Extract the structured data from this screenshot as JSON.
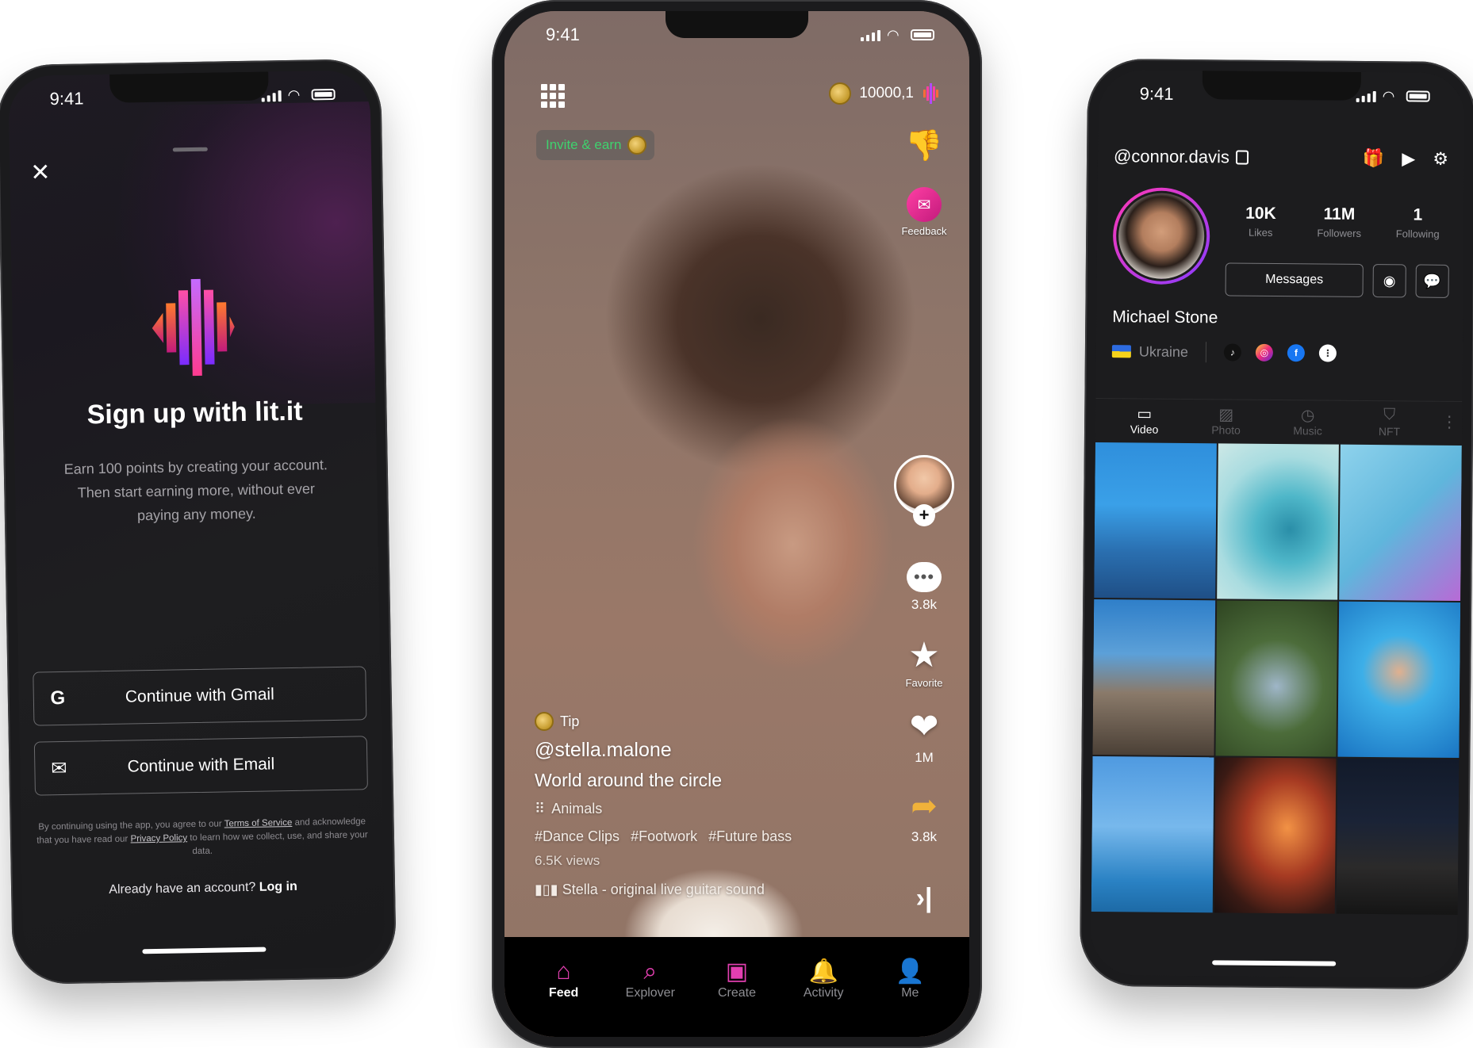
{
  "signup": {
    "status_time": "9:41",
    "title": "Sign up with lit.it",
    "description": "Earn 100 points by creating your account. Then start earning more, without ever paying any money.",
    "gmail_button": "Continue with Gmail",
    "gmail_icon_glyph": "G",
    "email_button": "Continue with Email",
    "legal_prefix": "By continuing using the app, you agree to our",
    "legal_terms": "Terms of Service",
    "legal_middle": "and acknowledge that you have read our",
    "legal_privacy": "Privacy Policy",
    "legal_suffix": "to learn how we collect, use, and share your data.",
    "have_account": "Already have an account?",
    "login": "Log in",
    "icons": [
      "close-icon",
      "google-icon",
      "mail-icon",
      "lit-logo"
    ]
  },
  "feed": {
    "status_time": "9:41",
    "points": "10000,1",
    "invite": "Invite & earn",
    "feedback_label": "Feedback",
    "comments_count": "3.8k",
    "favorite_label": "Favorite",
    "likes_count": "1M",
    "shares_count": "3.8k",
    "tip": "Tip",
    "username": "@stella.malone",
    "video_title": "World around the circle",
    "category": "Animals",
    "hashtags": [
      "#Dance Clips",
      "#Footwork",
      "#Future bass"
    ],
    "views": "6.5K views",
    "sound": "Stella - original live guitar sound",
    "tabs": [
      {
        "label": "Feed",
        "icon": "home-icon"
      },
      {
        "label": "Explover",
        "icon": "search-icon"
      },
      {
        "label": "Create",
        "icon": "video-camera-icon"
      },
      {
        "label": "Activity",
        "icon": "bell-icon"
      },
      {
        "label": "Me",
        "icon": "person-icon"
      }
    ],
    "accent_color": "#e23fb0"
  },
  "profile": {
    "status_time": "9:41",
    "handle": "@connor.davis",
    "likes_value": "10K",
    "likes_label": "Likes",
    "followers_value": "11M",
    "followers_label": "Followers",
    "following_value": "1",
    "following_label": "Following",
    "messages_button": "Messages",
    "name": "Michael Stone",
    "country": "Ukraine",
    "tabs": [
      "Video",
      "Photo",
      "Music",
      "NFT"
    ],
    "social_icons": [
      "tiktok-icon",
      "instagram-icon",
      "facebook-icon",
      "more-icon"
    ]
  }
}
